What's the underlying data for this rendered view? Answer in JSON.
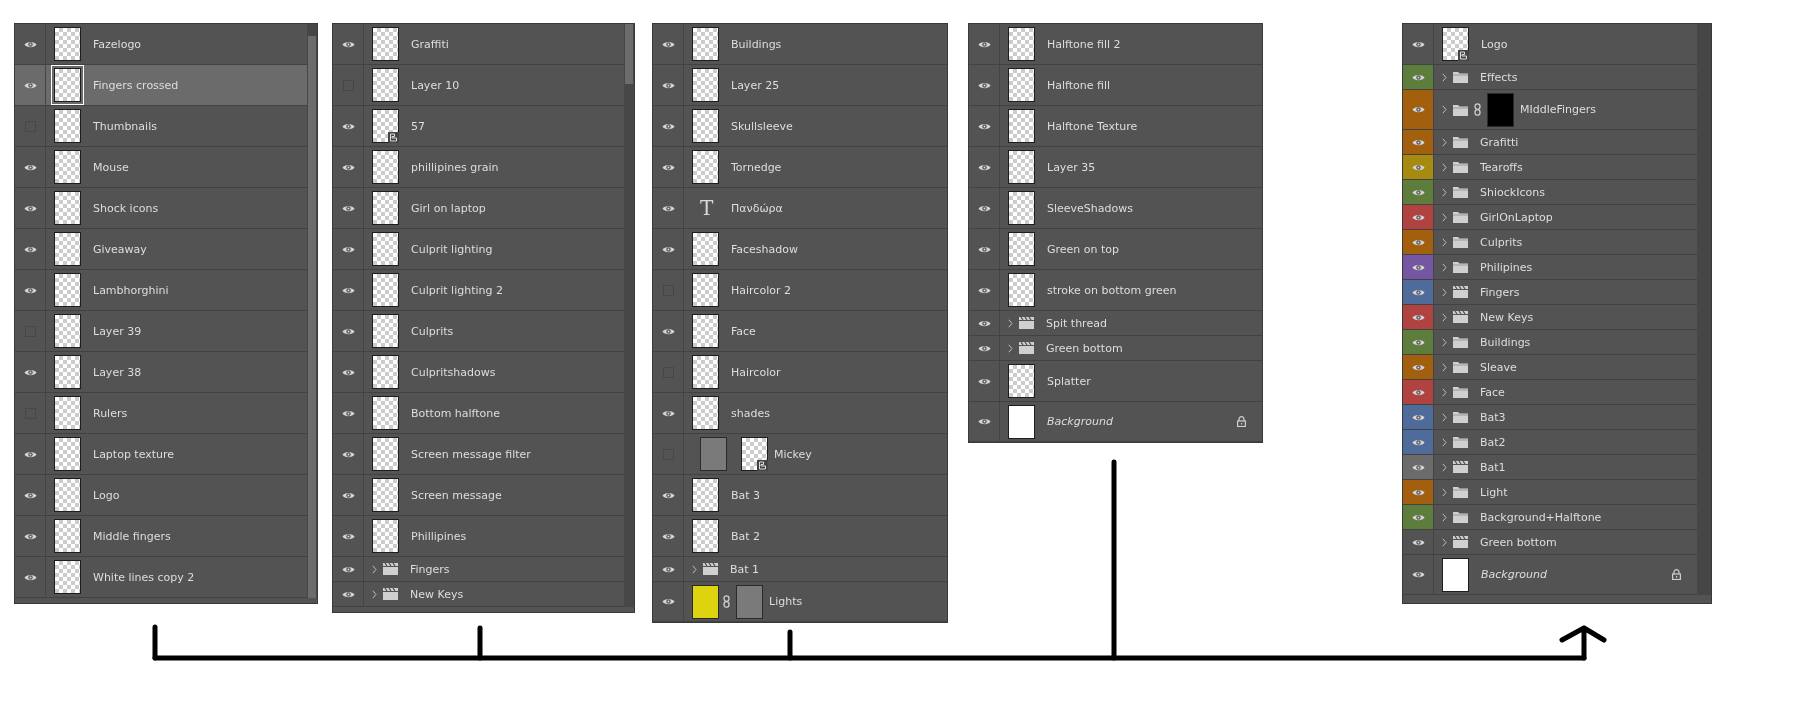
{
  "panels": [
    {
      "kind": "full-scroll",
      "layers": [
        {
          "kind": "layer",
          "name": "Fazelogo",
          "visible": true,
          "selected": false
        },
        {
          "kind": "layer",
          "name": "Fingers crossed",
          "visible": true,
          "selected": true
        },
        {
          "kind": "layer",
          "name": "Thumbnails",
          "visible": false,
          "selected": false
        },
        {
          "kind": "layer",
          "name": "Mouse",
          "visible": true,
          "selected": false
        },
        {
          "kind": "layer",
          "name": "Shock icons",
          "visible": true,
          "selected": false
        },
        {
          "kind": "layer",
          "name": "Giveaway",
          "visible": true,
          "selected": false
        },
        {
          "kind": "layer",
          "name": "Lambhorghini",
          "visible": true,
          "selected": false
        },
        {
          "kind": "layer",
          "name": "Layer 39",
          "visible": false,
          "selected": false
        },
        {
          "kind": "layer",
          "name": "Layer 38",
          "visible": true,
          "selected": false
        },
        {
          "kind": "layer",
          "name": "Rulers",
          "visible": false,
          "selected": false
        },
        {
          "kind": "layer",
          "name": "Laptop texture",
          "visible": true,
          "selected": false
        },
        {
          "kind": "layer",
          "name": "Logo",
          "visible": true,
          "selected": false
        },
        {
          "kind": "layer",
          "name": "Middle fingers",
          "visible": true,
          "selected": false
        },
        {
          "kind": "layer",
          "name": "White lines copy 2",
          "visible": true,
          "selected": false
        }
      ]
    },
    {
      "kind": "top-scroll",
      "layers": [
        {
          "kind": "layer",
          "name": "Graffiti",
          "visible": true,
          "selected": false
        },
        {
          "kind": "layer",
          "name": "Layer 10",
          "visible": false,
          "selected": false
        },
        {
          "kind": "smart",
          "name": "57",
          "visible": true,
          "selected": false
        },
        {
          "kind": "layer",
          "name": "phillipines grain",
          "visible": true,
          "selected": false
        },
        {
          "kind": "layer",
          "name": "Girl on laptop",
          "visible": true,
          "selected": false
        },
        {
          "kind": "layer",
          "name": "Culprit lighting",
          "visible": true,
          "selected": false
        },
        {
          "kind": "layer",
          "name": "Culprit lighting 2",
          "visible": true,
          "selected": false
        },
        {
          "kind": "layer",
          "name": "Culprits",
          "visible": true,
          "selected": false
        },
        {
          "kind": "layer",
          "name": "Culpritshadows",
          "visible": true,
          "selected": false
        },
        {
          "kind": "layer",
          "name": "Bottom halftone",
          "visible": true,
          "selected": false
        },
        {
          "kind": "layer",
          "name": "Screen message filter",
          "visible": true,
          "selected": false
        },
        {
          "kind": "layer",
          "name": "Screen message",
          "visible": true,
          "selected": false
        },
        {
          "kind": "layer",
          "name": "Phillipines",
          "visible": true,
          "selected": false
        },
        {
          "kind": "video",
          "name": "Fingers",
          "visible": true,
          "selected": false
        },
        {
          "kind": "video",
          "name": "New Keys",
          "visible": true,
          "selected": false
        }
      ]
    },
    {
      "kind": "plain",
      "layers": [
        {
          "kind": "layer",
          "name": "Buildings",
          "visible": true,
          "selected": false
        },
        {
          "kind": "layer",
          "name": "Layer 25",
          "visible": true,
          "selected": false
        },
        {
          "kind": "layer",
          "name": "Skullsleeve",
          "visible": true,
          "selected": false
        },
        {
          "kind": "layer",
          "name": "Tornedge",
          "visible": true,
          "selected": false
        },
        {
          "kind": "text",
          "glyph": "T",
          "name": "Πανδώρα",
          "visible": true,
          "selected": false
        },
        {
          "kind": "layer",
          "name": "Faceshadow",
          "visible": true,
          "selected": false
        },
        {
          "kind": "layer",
          "name": "Haircolor 2",
          "visible": false,
          "selected": false
        },
        {
          "kind": "layer",
          "name": "Face",
          "visible": true,
          "selected": false
        },
        {
          "kind": "layer",
          "name": "Haircolor",
          "visible": false,
          "selected": false
        },
        {
          "kind": "layer",
          "name": "shades",
          "visible": true,
          "selected": false
        },
        {
          "kind": "smart-masked",
          "name": "Mickey",
          "visible": false,
          "selected": false
        },
        {
          "kind": "layer",
          "name": "Bat 3",
          "visible": true,
          "selected": false
        },
        {
          "kind": "layer",
          "name": "Bat 2",
          "visible": true,
          "selected": false
        },
        {
          "kind": "video",
          "name": "Bat 1",
          "visible": true,
          "selected": false
        },
        {
          "kind": "fill",
          "name": "Lights",
          "visible": true,
          "selected": false
        }
      ]
    },
    {
      "kind": "plain",
      "layers": [
        {
          "kind": "layer",
          "name": "Halftone fill 2",
          "visible": true,
          "selected": false
        },
        {
          "kind": "layer",
          "name": "Halftone fill",
          "visible": true,
          "selected": false
        },
        {
          "kind": "layer",
          "name": "Halftone Texture",
          "visible": true,
          "selected": false
        },
        {
          "kind": "layer",
          "name": "Layer 35",
          "visible": true,
          "selected": false
        },
        {
          "kind": "layer",
          "name": "SleeveShadows",
          "visible": true,
          "selected": false
        },
        {
          "kind": "layer",
          "name": "Green on top",
          "visible": true,
          "selected": false
        },
        {
          "kind": "layer",
          "name": "stroke on bottom green",
          "visible": true,
          "selected": false
        },
        {
          "kind": "video",
          "name": "Spit thread",
          "visible": true,
          "selected": false
        },
        {
          "kind": "video",
          "name": "Green bottom",
          "visible": true,
          "selected": false
        },
        {
          "kind": "layer",
          "name": "Splatter",
          "visible": true,
          "selected": false
        },
        {
          "kind": "background",
          "name": "Background",
          "visible": true,
          "selected": false
        }
      ]
    },
    {
      "kind": "empty-scroll",
      "layers": [
        {
          "kind": "smart",
          "name": "Logo",
          "visible": true,
          "selected": false
        },
        {
          "kind": "group",
          "name": "Effects",
          "visible": true,
          "selected": false,
          "color": "#5c7d3b"
        },
        {
          "kind": "group-masked",
          "name": "MIddleFingers",
          "visible": true,
          "selected": false,
          "color": "#a25f0e"
        },
        {
          "kind": "group",
          "name": "Grafitti",
          "visible": true,
          "selected": false,
          "color": "#a25f0e"
        },
        {
          "kind": "group",
          "name": "Tearoffs",
          "visible": true,
          "selected": false,
          "color": "#a68b10"
        },
        {
          "kind": "group",
          "name": "ShiockIcons",
          "visible": true,
          "selected": false,
          "color": "#5c7d3b"
        },
        {
          "kind": "group",
          "name": "GirlOnLaptop",
          "visible": true,
          "selected": false,
          "color": "#b0423f"
        },
        {
          "kind": "group",
          "name": "Culprits",
          "visible": true,
          "selected": false,
          "color": "#a25f0e"
        },
        {
          "kind": "group",
          "name": "Philipines",
          "visible": true,
          "selected": false,
          "color": "#7556a3"
        },
        {
          "kind": "video",
          "name": "Fingers",
          "visible": true,
          "selected": false,
          "color": "#4f6b99"
        },
        {
          "kind": "video",
          "name": "New Keys",
          "visible": true,
          "selected": false,
          "color": "#b0423f"
        },
        {
          "kind": "group",
          "name": "Buildings",
          "visible": true,
          "selected": false,
          "color": "#5c7d3b"
        },
        {
          "kind": "group",
          "name": "Sleave",
          "visible": true,
          "selected": false,
          "color": "#a25f0e"
        },
        {
          "kind": "group",
          "name": "Face",
          "visible": true,
          "selected": false,
          "color": "#b0423f"
        },
        {
          "kind": "group",
          "name": "Bat3",
          "visible": true,
          "selected": false,
          "color": "#4f6b99"
        },
        {
          "kind": "group",
          "name": "Bat2",
          "visible": true,
          "selected": false,
          "color": "#4f6b99"
        },
        {
          "kind": "video",
          "name": "Bat1",
          "visible": true,
          "selected": false,
          "color": "#6b6b6b"
        },
        {
          "kind": "group",
          "name": "Light",
          "visible": true,
          "selected": false,
          "color": "#a25f0e"
        },
        {
          "kind": "group",
          "name": "Background+Halftone",
          "visible": true,
          "selected": false,
          "color": "#5c7d3b"
        },
        {
          "kind": "video",
          "name": "Green bottom",
          "visible": true,
          "selected": false
        },
        {
          "kind": "background",
          "name": "Background",
          "visible": true,
          "selected": false
        }
      ]
    }
  ]
}
